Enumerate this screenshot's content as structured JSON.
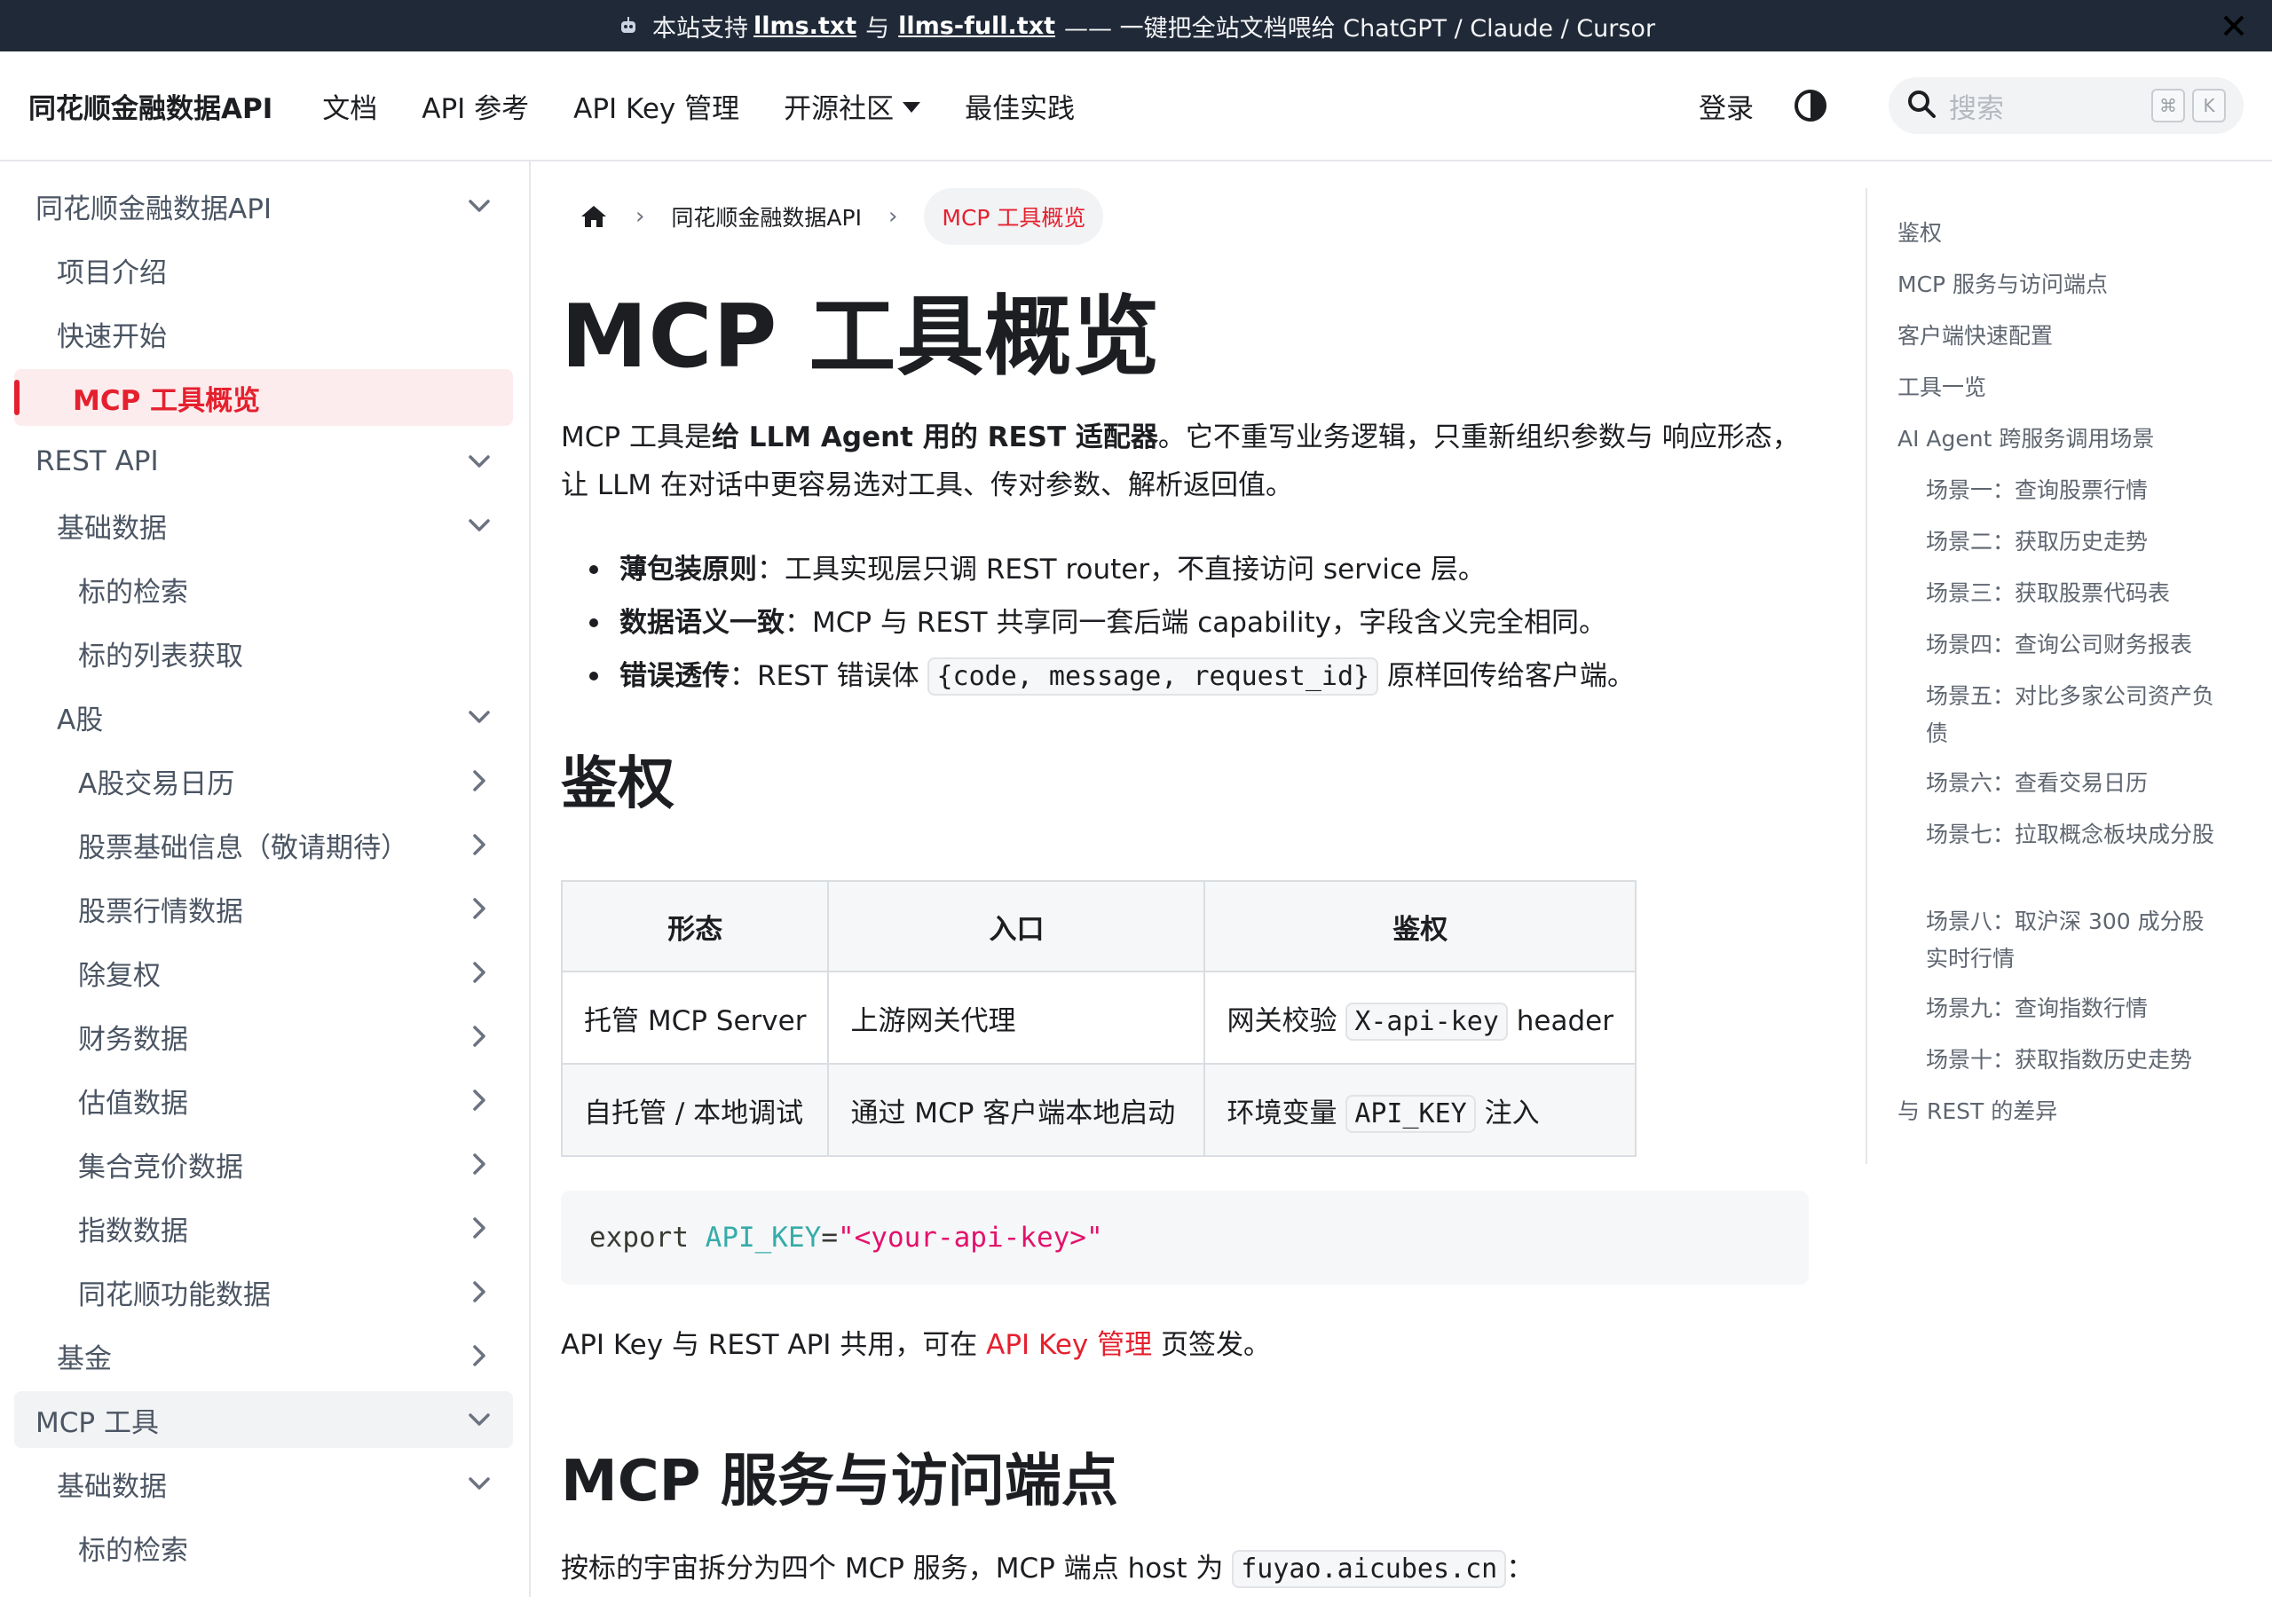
{
  "announcement": {
    "text_before": "本站支持",
    "link1": "llms.txt",
    "text_mid": "与",
    "link2": "llms-full.txt",
    "text_after": "—— 一键把全站文档喂给 ChatGPT / Claude / Cursor",
    "icon": "robot-icon"
  },
  "navbar": {
    "brand": "同花顺金融数据API",
    "links": [
      "文档",
      "API 参考",
      "API Key 管理",
      "开源社区",
      "最佳实践"
    ],
    "login": "登录",
    "search_placeholder": "搜索",
    "kbd1": "⌘",
    "kbd2": "K"
  },
  "sidebar": {
    "items": [
      {
        "label": "同花顺金融数据API",
        "level": 0,
        "chevron": "down"
      },
      {
        "label": "项目介绍",
        "level": 1
      },
      {
        "label": "快速开始",
        "level": 1
      },
      {
        "label": "MCP 工具概览",
        "level": 1,
        "active": true
      },
      {
        "label": "REST API",
        "level": 0,
        "chevron": "down"
      },
      {
        "label": "基础数据",
        "level": 1,
        "chevron": "down"
      },
      {
        "label": "标的检索",
        "level": 2
      },
      {
        "label": "标的列表获取",
        "level": 2
      },
      {
        "label": "A股",
        "level": 1,
        "chevron": "down"
      },
      {
        "label": "A股交易日历",
        "level": 2,
        "chevron": "right"
      },
      {
        "label": "股票基础信息（敬请期待）",
        "level": 2,
        "chevron": "right"
      },
      {
        "label": "股票行情数据",
        "level": 2,
        "chevron": "right"
      },
      {
        "label": "除复权",
        "level": 2,
        "chevron": "right"
      },
      {
        "label": "财务数据",
        "level": 2,
        "chevron": "right"
      },
      {
        "label": "估值数据",
        "level": 2,
        "chevron": "right"
      },
      {
        "label": "集合竞价数据",
        "level": 2,
        "chevron": "right"
      },
      {
        "label": "指数数据",
        "level": 2,
        "chevron": "right"
      },
      {
        "label": "同花顺功能数据",
        "level": 2,
        "chevron": "right"
      },
      {
        "label": "基金",
        "level": 1,
        "chevron": "right"
      },
      {
        "label": "MCP 工具",
        "level": 0,
        "chevron": "down",
        "highlight": true
      },
      {
        "label": "基础数据",
        "level": 1,
        "chevron": "down"
      },
      {
        "label": "标的检索",
        "level": 2
      }
    ]
  },
  "breadcrumb": {
    "home_icon": "home-icon",
    "crumb1": "同花顺金融数据API",
    "current": "MCP 工具概览"
  },
  "article": {
    "title": "MCP 工具概览",
    "intro": {
      "p1": "MCP 工具是",
      "b1": "给 LLM Agent 用的 REST 适配器",
      "p2": "。它不重写业务逻辑，只重新组织参数与 响应形态，",
      "line2": "让 LLM 在对话中更容易选对工具、传对参数、解析返回值。"
    },
    "bullets": [
      {
        "bold": "薄包装原则",
        "text": "：工具实现层只调 REST router，不直接访问 service 层。"
      },
      {
        "bold": "数据语义一致",
        "text": "：MCP 与 REST 共享同一套后端 capability，字段含义完全相同。"
      },
      {
        "bold": "错误透传",
        "text_before": "：REST 错误体 ",
        "code": "{code, message, request_id}",
        "text_after": " 原样回传给客户端。"
      }
    ],
    "h2_auth": "鉴权",
    "auth_table": {
      "headers": [
        "形态",
        "入口",
        "鉴权"
      ],
      "rows": [
        {
          "form": "托管 MCP Server",
          "entry": "上游网关代理",
          "auth_before": "网关校验 ",
          "auth_code": "X-api-key",
          "auth_after": " header"
        },
        {
          "form": "自托管 / 本地调试",
          "entry": "通过 MCP 客户端本地启动",
          "auth_before": "环境变量 ",
          "auth_code": "API_KEY",
          "auth_after": " 注入"
        }
      ]
    },
    "code": {
      "cmd": "export",
      "var": "API_KEY",
      "eq": "=",
      "str": "\"<your-api-key>\""
    },
    "key_para": {
      "before": "API Key 与 REST API 共用，可在 ",
      "link": "API Key 管理",
      "after": " 页签发。"
    },
    "h2_service": "MCP 服务与访问端点",
    "host_para": {
      "before": "按标的宇宙拆分为四个 MCP 服务，MCP 端点 host 为 ",
      "code": "fuyao.aicubes.cn",
      "after": "："
    }
  },
  "toc": [
    {
      "label": "鉴权",
      "sub": false
    },
    {
      "label": "MCP 服务与访问端点",
      "sub": false
    },
    {
      "label": "客户端快速配置",
      "sub": false
    },
    {
      "label": "工具一览",
      "sub": false
    },
    {
      "label": "AI Agent 跨服务调用场景",
      "sub": false
    },
    {
      "label": "场景一：查询股票行情",
      "sub": true
    },
    {
      "label": "场景二：获取历史走势",
      "sub": true
    },
    {
      "label": "场景三：获取股票代码表",
      "sub": true
    },
    {
      "label": "场景四：查询公司财务报表",
      "sub": true
    },
    {
      "label": "场景五：对比多家公司资产负债",
      "sub": true
    },
    {
      "label": "场景六：查看交易日历",
      "sub": true
    },
    {
      "label": "场景七：拉取概念板块成分股",
      "sub": true
    },
    {
      "label": "场景八：取沪深 300 成分股实时行情",
      "sub": true
    },
    {
      "label": "场景九：查询指数行情",
      "sub": true
    },
    {
      "label": "场景十：获取指数历史走势",
      "sub": true
    },
    {
      "label": "与 REST 的差异",
      "sub": false
    }
  ],
  "colors": {
    "accent": "#e5202e",
    "announce_bg": "#1f2937",
    "active_bg": "#fdecee"
  }
}
